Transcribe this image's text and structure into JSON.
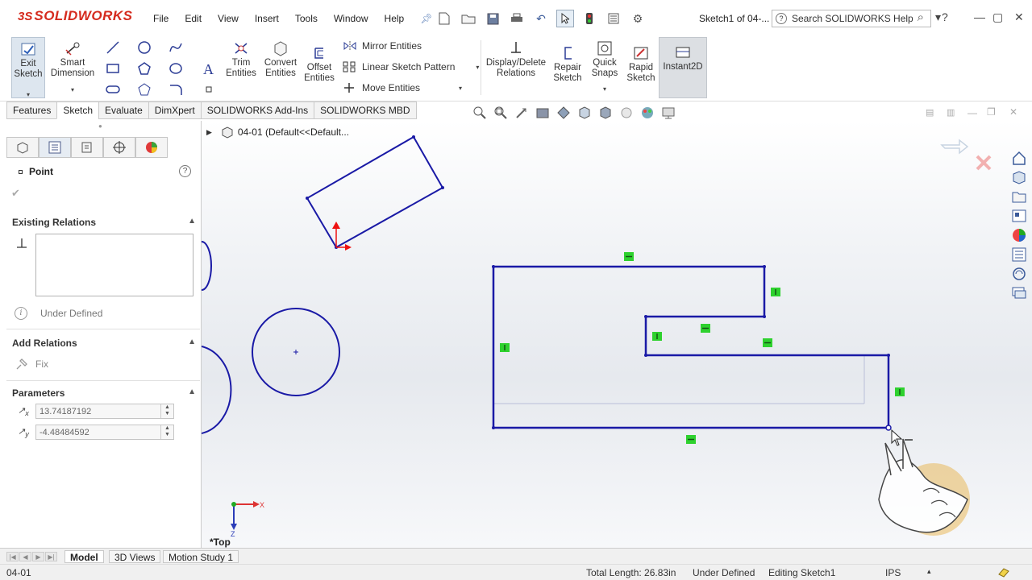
{
  "app": {
    "brand_prefix": "3S",
    "brand": "SOLIDWORKS",
    "doc_title": "Sketch1 of 04-...",
    "search_placeholder": "Search SOLIDWORKS Help",
    "menus": [
      "File",
      "Edit",
      "View",
      "Insert",
      "Tools",
      "Window",
      "Help"
    ]
  },
  "commandmanager": {
    "exit_sketch": "Exit Sketch",
    "smart_dimension": "Smart Dimension",
    "trim_entities": "Trim Entities",
    "convert_entities": "Convert Entities",
    "offset_entities": "Offset Entities",
    "mirror_entities": "Mirror Entities",
    "linear_sketch_pattern": "Linear Sketch Pattern",
    "move_entities": "Move Entities",
    "display_delete_relations": "Display/Delete Relations",
    "repair_sketch": "Repair Sketch",
    "quick_snaps": "Quick Snaps",
    "rapid_sketch": "Rapid Sketch",
    "instant2d": "Instant2D"
  },
  "tabs": [
    "Features",
    "Sketch",
    "Evaluate",
    "DimXpert",
    "SOLIDWORKS Add-Ins",
    "SOLIDWORKS MBD"
  ],
  "active_tab": "Sketch",
  "property_manager": {
    "title": "Point",
    "existing_relations": "Existing Relations",
    "under_defined": "Under Defined",
    "add_relations": "Add Relations",
    "fix": "Fix",
    "parameters": "Parameters",
    "x_label": "x",
    "y_label": "y",
    "x_value": "13.74187192",
    "y_value": "-4.48484592"
  },
  "graphics": {
    "tree_node": "04-01  (Default<<Default...",
    "view_name": "*Top",
    "triad_x": "X",
    "triad_y": "Z",
    "sketch_color": "#1a1aa6",
    "relation_color": "#2ed12e"
  },
  "bottom_tabs": [
    "Model",
    "3D Views",
    "Motion Study 1"
  ],
  "status": {
    "doc": "04-01",
    "total_length": "Total Length: 26.83in",
    "state": "Under Defined",
    "editing": "Editing Sketch1",
    "units": "IPS"
  }
}
